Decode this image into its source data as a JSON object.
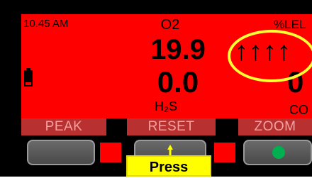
{
  "status_bar": {
    "time": "10.45 AM",
    "o2_label": "O2",
    "lel_label": "%LEL"
  },
  "readings": {
    "o2_value": "19.9",
    "h2s_value": "0.0",
    "h2s_label": "H₂S",
    "co_value": "0",
    "co_label": "CO",
    "lel_indicator": "↑↑↑↑"
  },
  "softkeys": {
    "left": "PEAK",
    "center": "RESET",
    "right": "ZOOM"
  },
  "callout": {
    "press_label": "Press"
  },
  "colors": {
    "screen_bg": "#fe0000",
    "softkey_bg": "#b8302f",
    "softkey_text": "#f4a2a2",
    "highlight_ring": "#ffff33",
    "callout_bg": "#ffff00",
    "power_led": "#00b050"
  },
  "icons": [
    "battery-icon",
    "up-arrow-icon",
    "power-indicator-icon"
  ]
}
